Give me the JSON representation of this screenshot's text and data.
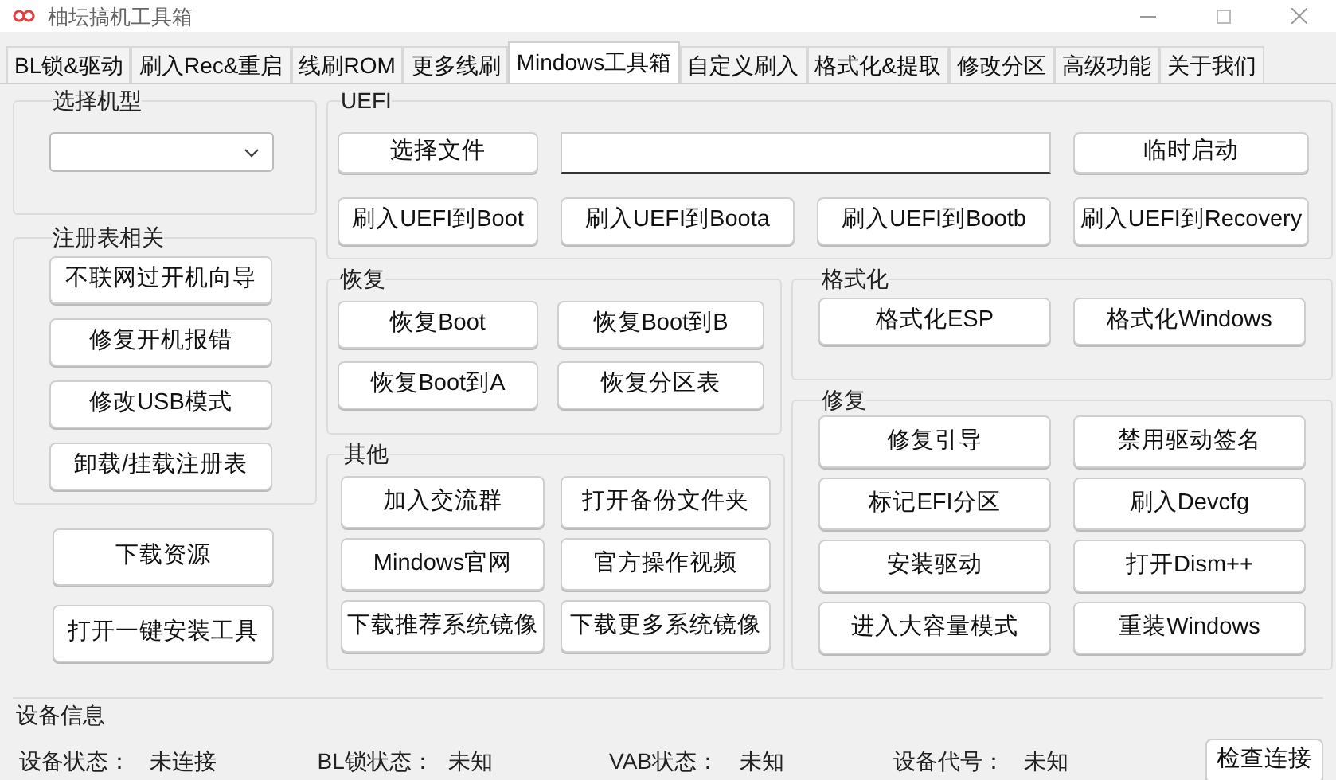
{
  "window": {
    "title": "柚坛搞机工具箱"
  },
  "tabs": [
    {
      "label": "BL锁&驱动",
      "selected": false
    },
    {
      "label": "刷入Rec&重启",
      "selected": false
    },
    {
      "label": "线刷ROM",
      "selected": false
    },
    {
      "label": "更多线刷",
      "selected": false
    },
    {
      "label": "Mindows工具箱",
      "selected": true
    },
    {
      "label": "自定义刷入",
      "selected": false
    },
    {
      "label": "格式化&提取",
      "selected": false
    },
    {
      "label": "修改分区",
      "selected": false
    },
    {
      "label": "高级功能",
      "selected": false
    },
    {
      "label": "关于我们",
      "selected": false
    }
  ],
  "model_group": {
    "title": "选择机型"
  },
  "registry_group": {
    "title": "注册表相关",
    "buttons": [
      "不联网过开机向导",
      "修复开机报错",
      "修改USB模式",
      "卸载/挂载注册表"
    ]
  },
  "left_buttons": [
    "下载资源",
    "打开一键安装工具"
  ],
  "uefi_group": {
    "title": "UEFI",
    "select_button": "选择文件",
    "temp_boot_button": "临时启动",
    "flash_buttons": [
      "刷入UEFI到Boot",
      "刷入UEFI到Boota",
      "刷入UEFI到Bootb",
      "刷入UEFI到Recovery"
    ]
  },
  "restore_group": {
    "title": "恢复",
    "buttons": [
      "恢复Boot",
      "恢复Boot到B",
      "恢复Boot到A",
      "恢复分区表"
    ]
  },
  "format_group": {
    "title": "格式化",
    "buttons": [
      "格式化ESP",
      "格式化Windows"
    ]
  },
  "other_group": {
    "title": "其他",
    "buttons": [
      "加入交流群",
      "打开备份文件夹",
      "Mindows官网",
      "官方操作视频",
      "下载推荐系统镜像",
      "下载更多系统镜像"
    ]
  },
  "repair_group": {
    "title": "修复",
    "buttons": [
      "修复引导",
      "禁用驱动签名",
      "标记EFI分区",
      "刷入Devcfg",
      "安装驱动",
      "打开Dism++",
      "进入大容量模式",
      "重装Windows"
    ]
  },
  "device_info": {
    "title": "设备信息",
    "fields": [
      {
        "label": "设备状态：",
        "value": "未连接"
      },
      {
        "label": "BL锁状态：",
        "value": "未知"
      },
      {
        "label": "VAB状态：",
        "value": "未知"
      },
      {
        "label": "设备代号：",
        "value": "未知"
      }
    ],
    "check_button": "检查连接"
  }
}
